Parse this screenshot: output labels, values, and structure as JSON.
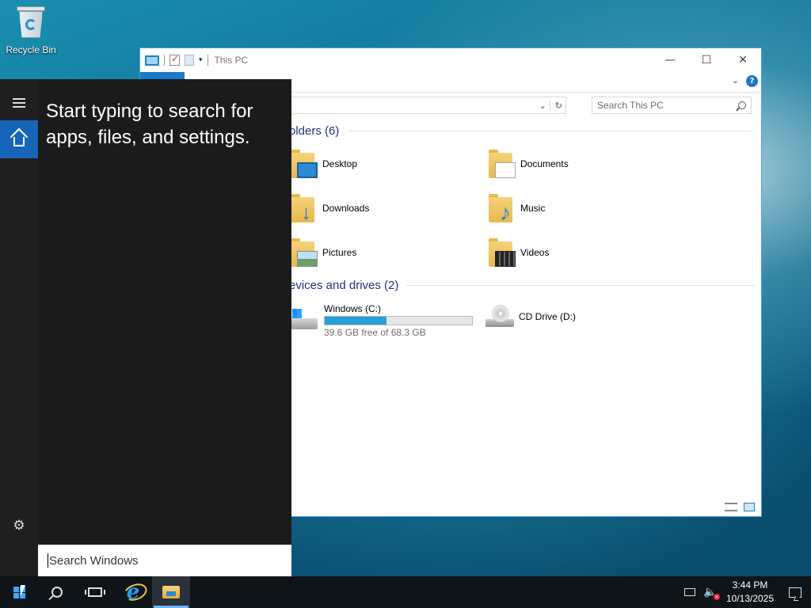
{
  "desktop": {
    "icons": [
      {
        "label": "Recycle Bin",
        "icon": "recycle-bin-icon"
      }
    ]
  },
  "explorer": {
    "title": "This PC",
    "search_placeholder": "Search This PC",
    "groups": {
      "folders": {
        "header": "olders (6)"
      },
      "devices": {
        "header": "evices and drives (2)"
      }
    },
    "folders": [
      {
        "label": "Desktop",
        "icon": "desktop-folder-icon"
      },
      {
        "label": "Documents",
        "icon": "documents-folder-icon"
      },
      {
        "label": "Downloads",
        "icon": "downloads-folder-icon"
      },
      {
        "label": "Music",
        "icon": "music-folder-icon"
      },
      {
        "label": "Pictures",
        "icon": "pictures-folder-icon"
      },
      {
        "label": "Videos",
        "icon": "videos-folder-icon"
      }
    ],
    "drives": [
      {
        "label": "Windows (C:)",
        "free_text": "39.6 GB free of 68.3 GB",
        "used_fraction": 0.42,
        "icon": "hard-drive-icon"
      },
      {
        "label": "CD Drive (D:)",
        "icon": "cd-drive-icon"
      }
    ]
  },
  "start_menu": {
    "prompt": "Start typing to search for apps, files, and settings.",
    "search_placeholder": "Search Windows",
    "accent_color": "#1665b7"
  },
  "taskbar": {
    "time": "3:44 PM",
    "date": "10/13/2025",
    "accent_color": "#3fa7ff"
  }
}
